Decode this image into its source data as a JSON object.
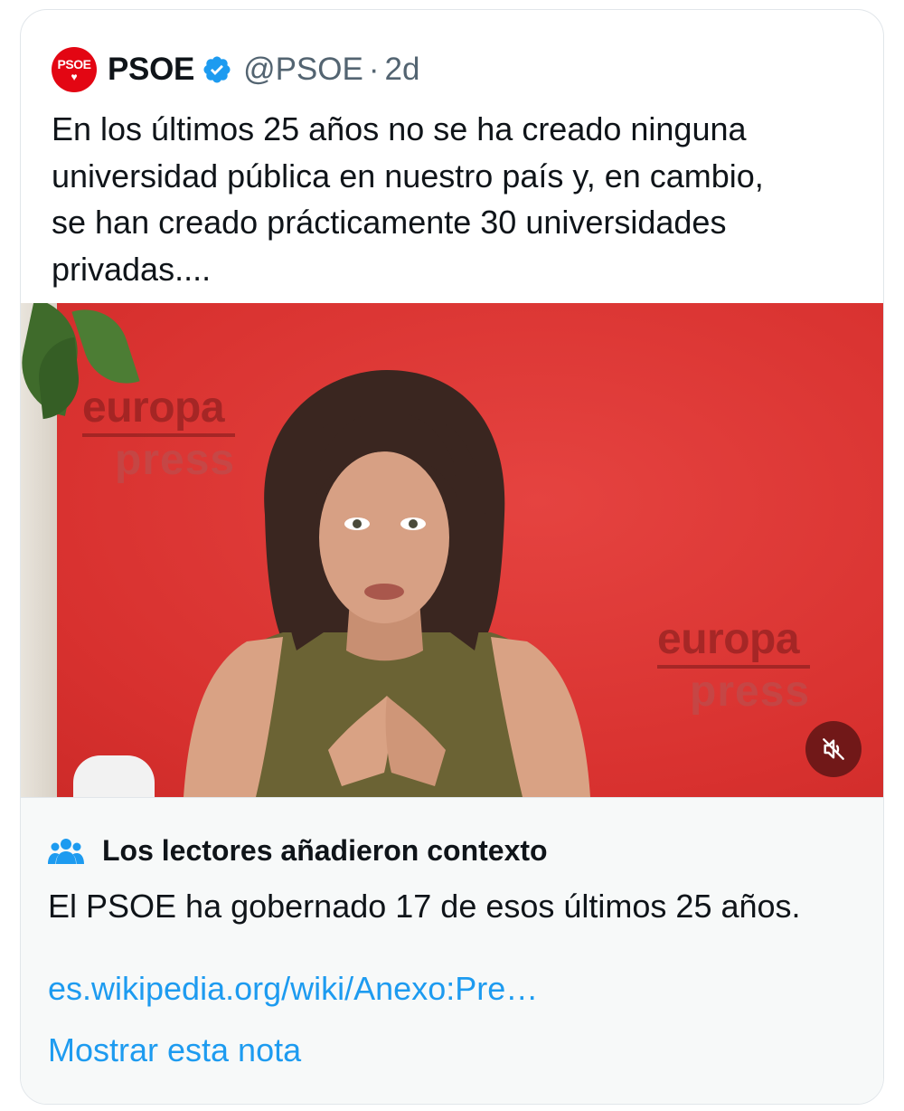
{
  "tweet": {
    "avatar_text": "PSOE",
    "avatar_symbol": "♥",
    "display_name": "PSOE",
    "verified": true,
    "handle": "@PSOE",
    "separator": "·",
    "time": "2d",
    "text": "En los últimos 25 años no se ha creado ninguna\nuniversidad pública en nuestro país y, en cambio,\nse han creado prácticamente 30 universidades\nprivadas...."
  },
  "media": {
    "type": "video",
    "watermark_top": "europa",
    "watermark_bottom": "press",
    "muted": true,
    "icon": "volume-off-icon"
  },
  "community_note": {
    "icon": "people-icon",
    "title": "Los lectores añadieron contexto",
    "body": "El PSOE ha gobernado 17 de esos últimos 25 años.",
    "link_text": "es.wikipedia.org/wiki/Anexo:Pre…",
    "show_note_label": "Mostrar esta nota"
  },
  "colors": {
    "brand_red": "#e30613",
    "verified_blue": "#1d9bf0",
    "link_blue": "#1d9bf0",
    "secondary_text": "#536471",
    "note_background": "#f7f9f9"
  }
}
